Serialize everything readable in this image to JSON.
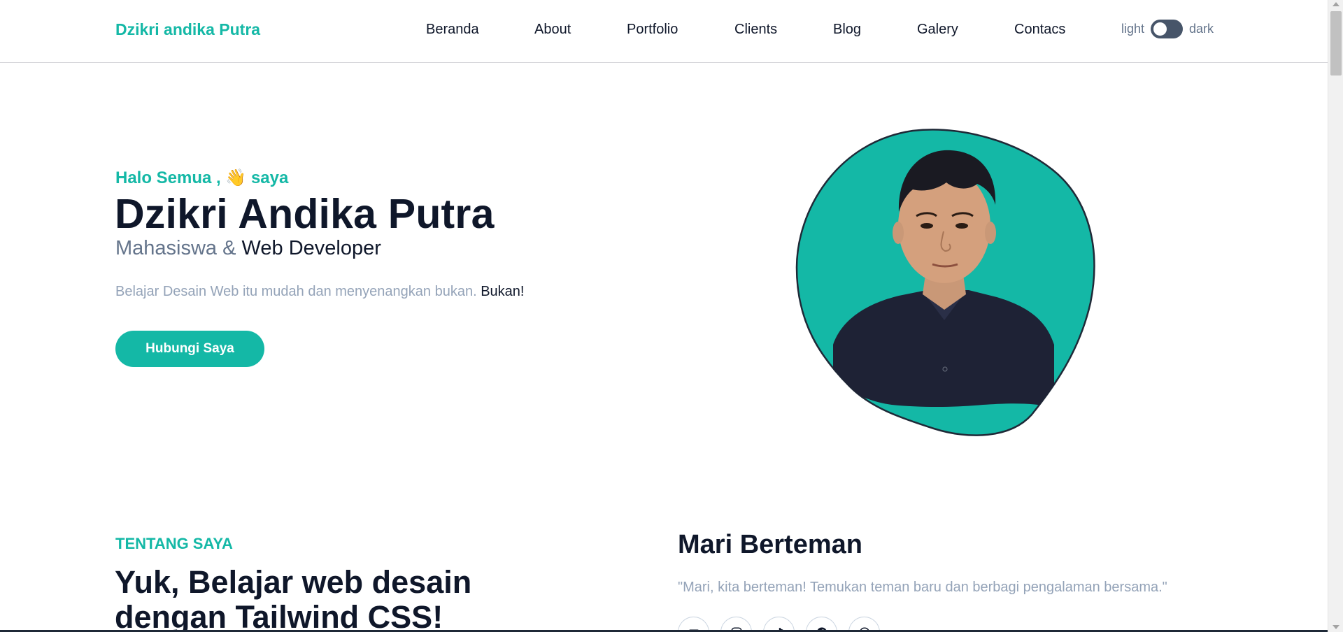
{
  "navbar": {
    "brand": "Dzikri andika Putra",
    "links": [
      "Beranda",
      "About",
      "Portfolio",
      "Clients",
      "Blog",
      "Galery",
      "Contacs"
    ],
    "toggle": {
      "light_label": "light",
      "dark_label": "dark",
      "state": "light"
    }
  },
  "hero": {
    "greeting_prefix": "Halo Semua ,",
    "greeting_emoji": "👋",
    "greeting_suffix": "saya",
    "name": "Dzikri Andika Putra",
    "role_prefix": "Mahasiswa &",
    "role_main": "Web Developer",
    "description": "Belajar Desain Web itu mudah dan menyenangkan bukan.",
    "description_strong": "Bukan!",
    "cta_label": "Hubungi Saya"
  },
  "about": {
    "kicker": "TENTANG SAYA",
    "title": "Yuk, Belajar web desain dengan Tailwind CSS!",
    "friend_title": "Mari Berteman",
    "friend_quote": "\"Mari, kita berteman! Temukan teman baru dan berbagi pengalaman bersama.\"",
    "socials": [
      "youtube-icon",
      "instagram-icon",
      "tiktok-icon",
      "facebook-icon",
      "whatsapp-icon"
    ]
  },
  "colors": {
    "accent": "#14b8a6",
    "text_dark": "#0f172a",
    "text_muted": "#64748b",
    "text_light": "#94a3b8"
  }
}
